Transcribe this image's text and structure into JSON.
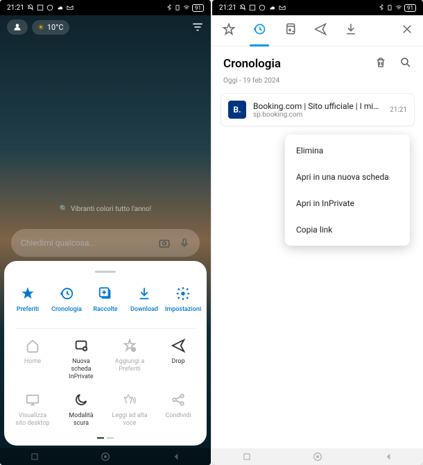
{
  "status": {
    "time": "21:21",
    "battery": "91"
  },
  "left": {
    "weather_temp": "10°C",
    "search_placeholder": "Chiedimi qualcosa...",
    "wallpaper_caption": "Vibranti colori tutto l'anno!",
    "sheet_row1": [
      {
        "label": "Preferiti",
        "icon": "star"
      },
      {
        "label": "Cronologia",
        "icon": "history"
      },
      {
        "label": "Raccolte",
        "icon": "collections"
      },
      {
        "label": "Download",
        "icon": "download"
      },
      {
        "label": "Impostazioni",
        "icon": "settings"
      }
    ],
    "sheet_row2": [
      {
        "label": "Home",
        "icon": "home"
      },
      {
        "label": "Nuova scheda InPrivate",
        "icon": "inprivate"
      },
      {
        "label": "Aggiungi a Preferiti",
        "icon": "addfav"
      },
      {
        "label": "Drop",
        "icon": "drop"
      }
    ],
    "sheet_row3": [
      {
        "label": "Visualizza sito desktop",
        "icon": "desktop"
      },
      {
        "label": "Modalità scura",
        "icon": "dark"
      },
      {
        "label": "Leggi ad alta voce",
        "icon": "read"
      },
      {
        "label": "Condividi",
        "icon": "share"
      }
    ]
  },
  "right": {
    "title": "Cronologia",
    "date_header": "Oggi - 19 feb 2024",
    "history": {
      "favicon_letter": "B.",
      "title": "Booking.com | Sito ufficiale | I migliori ho...",
      "url": "sp.booking.com",
      "time": "21:21"
    },
    "menu": [
      "Elimina",
      "Apri in una nuova scheda",
      "Apri in InPrivate",
      "Copia link"
    ]
  }
}
